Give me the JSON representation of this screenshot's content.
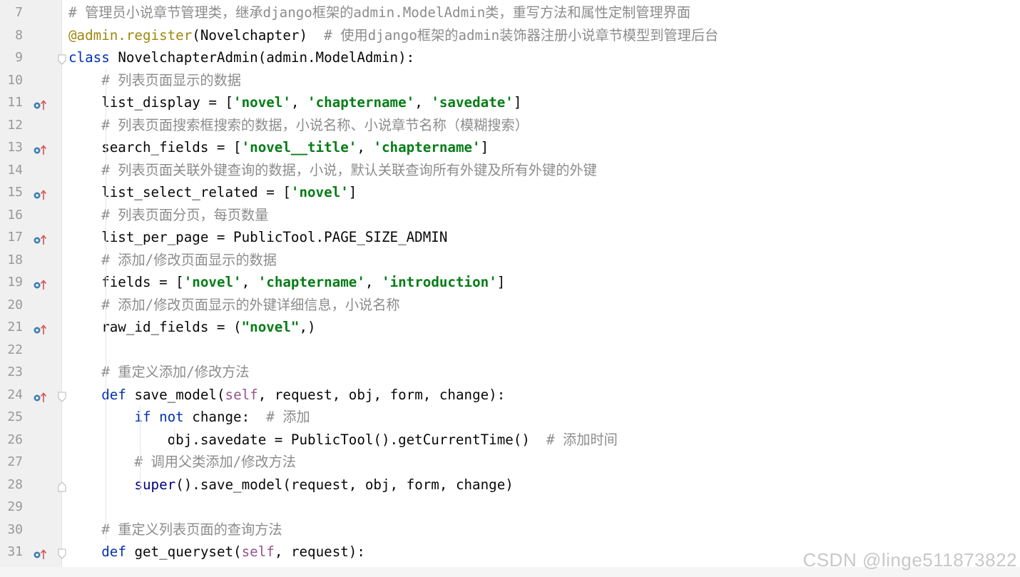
{
  "lines": [
    {
      "no": "7",
      "marker": false,
      "fold": "",
      "segments": [
        {
          "t": "# 管理员小说章节管理类，继承django框架的admin.ModelAdmin类，重写方法和属性定制管理界面",
          "c": "cmt"
        }
      ]
    },
    {
      "no": "8",
      "marker": false,
      "fold": "",
      "segments": [
        {
          "t": "@admin.register",
          "c": "deco"
        },
        {
          "t": "(Novelchapter)  ",
          "c": ""
        },
        {
          "t": "# 使用django框架的admin装饰器注册小说章节模型到管理后台",
          "c": "cmt"
        }
      ]
    },
    {
      "no": "9",
      "marker": false,
      "fold": "open",
      "segments": [
        {
          "t": "class ",
          "c": "kw"
        },
        {
          "t": "NovelchapterAdmin(admin.ModelAdmin):",
          "c": ""
        }
      ]
    },
    {
      "no": "10",
      "marker": false,
      "fold": "",
      "segments": [
        {
          "t": "    # 列表页面显示的数据",
          "c": "cmt"
        }
      ]
    },
    {
      "no": "11",
      "marker": true,
      "fold": "",
      "segments": [
        {
          "t": "    list_display = [",
          "c": ""
        },
        {
          "t": "'novel'",
          "c": "str"
        },
        {
          "t": ", ",
          "c": ""
        },
        {
          "t": "'chaptername'",
          "c": "str"
        },
        {
          "t": ", ",
          "c": ""
        },
        {
          "t": "'savedate'",
          "c": "str"
        },
        {
          "t": "]",
          "c": ""
        }
      ]
    },
    {
      "no": "12",
      "marker": false,
      "fold": "",
      "segments": [
        {
          "t": "    # 列表页面搜索框搜索的数据，小说名称、小说章节名称（模糊搜索）",
          "c": "cmt"
        }
      ]
    },
    {
      "no": "13",
      "marker": true,
      "fold": "",
      "segments": [
        {
          "t": "    search_fields = [",
          "c": ""
        },
        {
          "t": "'novel__title'",
          "c": "str"
        },
        {
          "t": ", ",
          "c": ""
        },
        {
          "t": "'chaptername'",
          "c": "str"
        },
        {
          "t": "]",
          "c": ""
        }
      ]
    },
    {
      "no": "14",
      "marker": false,
      "fold": "",
      "segments": [
        {
          "t": "    # 列表页面关联外键查询的数据，小说，默认关联查询所有外键及所有外键的外键",
          "c": "cmt"
        }
      ]
    },
    {
      "no": "15",
      "marker": true,
      "fold": "",
      "segments": [
        {
          "t": "    list_select_related = [",
          "c": ""
        },
        {
          "t": "'novel'",
          "c": "str"
        },
        {
          "t": "]",
          "c": ""
        }
      ]
    },
    {
      "no": "16",
      "marker": false,
      "fold": "",
      "segments": [
        {
          "t": "    # 列表页面分页，每页数量",
          "c": "cmt"
        }
      ]
    },
    {
      "no": "17",
      "marker": true,
      "fold": "",
      "segments": [
        {
          "t": "    list_per_page = PublicTool.PAGE_SIZE_ADMIN",
          "c": ""
        }
      ]
    },
    {
      "no": "18",
      "marker": false,
      "fold": "",
      "segments": [
        {
          "t": "    # 添加/修改页面显示的数据",
          "c": "cmt"
        }
      ]
    },
    {
      "no": "19",
      "marker": true,
      "fold": "",
      "segments": [
        {
          "t": "    fields = [",
          "c": ""
        },
        {
          "t": "'novel'",
          "c": "str"
        },
        {
          "t": ", ",
          "c": ""
        },
        {
          "t": "'chaptername'",
          "c": "str"
        },
        {
          "t": ", ",
          "c": ""
        },
        {
          "t": "'introduction'",
          "c": "str"
        },
        {
          "t": "]",
          "c": ""
        }
      ]
    },
    {
      "no": "20",
      "marker": false,
      "fold": "",
      "segments": [
        {
          "t": "    # 添加/修改页面显示的外键详细信息，小说名称",
          "c": "cmt"
        }
      ]
    },
    {
      "no": "21",
      "marker": true,
      "fold": "",
      "segments": [
        {
          "t": "    raw_id_fields = (",
          "c": ""
        },
        {
          "t": "\"novel\"",
          "c": "str"
        },
        {
          "t": ",)",
          "c": ""
        }
      ]
    },
    {
      "no": "22",
      "marker": false,
      "fold": "",
      "segments": []
    },
    {
      "no": "23",
      "marker": false,
      "fold": "",
      "segments": [
        {
          "t": "    # 重定义添加/修改方法",
          "c": "cmt"
        }
      ]
    },
    {
      "no": "24",
      "marker": true,
      "fold": "open",
      "segments": [
        {
          "t": "    ",
          "c": ""
        },
        {
          "t": "def ",
          "c": "kw"
        },
        {
          "t": "save_model(",
          "c": ""
        },
        {
          "t": "self",
          "c": "self"
        },
        {
          "t": ", request, obj, form, change):",
          "c": ""
        }
      ]
    },
    {
      "no": "25",
      "marker": false,
      "fold": "",
      "segments": [
        {
          "t": "        ",
          "c": ""
        },
        {
          "t": "if not ",
          "c": "kw"
        },
        {
          "t": "change:  ",
          "c": ""
        },
        {
          "t": "# 添加",
          "c": "cmt"
        }
      ]
    },
    {
      "no": "26",
      "marker": false,
      "fold": "",
      "segments": [
        {
          "t": "            obj.savedate = PublicTool().getCurrentTime()  ",
          "c": ""
        },
        {
          "t": "# 添加时间",
          "c": "cmt"
        }
      ]
    },
    {
      "no": "27",
      "marker": false,
      "fold": "",
      "segments": [
        {
          "t": "        # 调用父类添加/修改方法",
          "c": "cmt"
        }
      ]
    },
    {
      "no": "28",
      "marker": false,
      "fold": "close",
      "segments": [
        {
          "t": "        ",
          "c": ""
        },
        {
          "t": "super",
          "c": "builtin"
        },
        {
          "t": "().save_model(request, obj, form, change)",
          "c": ""
        }
      ]
    },
    {
      "no": "29",
      "marker": false,
      "fold": "",
      "segments": []
    },
    {
      "no": "30",
      "marker": false,
      "fold": "",
      "segments": [
        {
          "t": "    # 重定义列表页面的查询方法",
          "c": "cmt"
        }
      ]
    },
    {
      "no": "31",
      "marker": true,
      "fold": "open",
      "segments": [
        {
          "t": "    ",
          "c": ""
        },
        {
          "t": "def ",
          "c": "kw"
        },
        {
          "t": "get_queryset(",
          "c": ""
        },
        {
          "t": "self",
          "c": "self"
        },
        {
          "t": ", request):",
          "c": ""
        }
      ]
    }
  ],
  "watermark": "CSDN @linge511873822",
  "colors": {
    "keyword": "#0033b3",
    "string": "#067d17",
    "comment": "#8c8c8c",
    "decorator": "#9e880d",
    "self": "#94558d",
    "gutter_bg": "#f0f0f0",
    "marker_blue": "#3d7fb3",
    "marker_red": "#d9534f"
  },
  "icons": {
    "marker": "override-method-icon",
    "fold_open": "fold-open-icon",
    "fold_close": "fold-close-icon"
  }
}
